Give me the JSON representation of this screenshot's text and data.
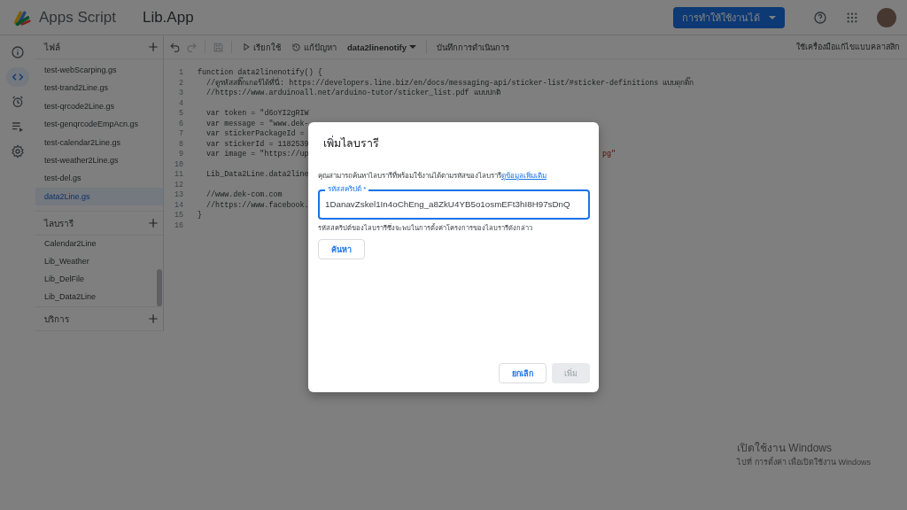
{
  "app": {
    "name": "Apps Script",
    "project": "Lib.App",
    "deploy_button": "การทำให้ใช้งานได้"
  },
  "rail": [
    {
      "kind": "info",
      "selected": false
    },
    {
      "kind": "code",
      "selected": true
    },
    {
      "kind": "alarm",
      "selected": false
    },
    {
      "kind": "runs",
      "selected": false
    },
    {
      "kind": "settings",
      "selected": false
    }
  ],
  "files": {
    "title": "ไฟล์",
    "items": [
      {
        "label": "test-webScarping.gs",
        "selected": false
      },
      {
        "label": "test-trand2Line.gs",
        "selected": false
      },
      {
        "label": "test-qrcode2Line.gs",
        "selected": false
      },
      {
        "label": "test-genqrcodeEmpAcn.gs",
        "selected": false
      },
      {
        "label": "test-calendar2Line.gs",
        "selected": false
      },
      {
        "label": "test-weather2Line.gs",
        "selected": false
      },
      {
        "label": "test-del.gs",
        "selected": false
      },
      {
        "label": "data2Line.gs",
        "selected": true
      }
    ]
  },
  "libraries": {
    "title": "ไลบรารี",
    "items": [
      "Calendar2Line",
      "Lib_Weather",
      "Lib_DelFile",
      "Lib_Data2Line"
    ]
  },
  "services": {
    "title": "บริการ"
  },
  "toolbar": {
    "run": "เรียกใช้",
    "debug": "แก้ปัญหา",
    "function": "data2linenotify",
    "log": "บันทึกการดำเนินการ",
    "classic": "ใช้เครื่องมือแก้ไขแบบคลาสสิก"
  },
  "code": [
    {
      "n": "1",
      "text": "function data2linenotify() {"
    },
    {
      "n": "2",
      "text": "  //ดูรหัสสติ๊กเกอร์ได้ที่นี่: https://developers.line.biz/en/docs/messaging-api/sticker-list/#sticker-definitions แบบดุกดิ๊ก"
    },
    {
      "n": "3",
      "text": "  //https://www.arduinoall.net/arduino-tutor/sticker_list.pdf แบบปกติ"
    },
    {
      "n": "4"
    },
    {
      "n": "5",
      "text": "  var token = \"d6oYI2gRIW"
    },
    {
      "n": "6",
      "text": "  var message = \"www.dek-"
    },
    {
      "n": "7",
      "text": "  var stickerPackageId = "
    },
    {
      "n": "8",
      "text": "  var stickerId = 1182539"
    },
    {
      "n": "9",
      "text": "  var image = \"https://up",
      "tail": "pg\""
    },
    {
      "n": "10"
    },
    {
      "n": "11",
      "text": "  Lib_Data2Line.data2line"
    },
    {
      "n": "12"
    },
    {
      "n": "13",
      "text": "  //www.dek-com.com"
    },
    {
      "n": "14",
      "text": "  //https://www.facebook."
    },
    {
      "n": "15",
      "text": "}"
    },
    {
      "n": "16"
    }
  ],
  "dialog": {
    "title": "เพิ่มไลบรารี",
    "description": "คุณสามารถค้นหาไลบรารีที่พร้อมใช้งานได้ตามรหัสของไลบรารี",
    "link": "ดูข้อมูลเพิ่มเติม",
    "field_label": "รหัสสคริปต์ *",
    "field_value": "1DanavZskel1In4oChEng_a8ZkU4YB5o1osmEFt3hI8H97sDnQ",
    "helper": "รหัสสคริปต์ของไลบรารีซึ่งจะพบในการตั้งค่าโครงการของไลบรารีดังกล่าว",
    "search_button": "ค้นหา",
    "cancel_button": "ยกเลิก",
    "add_button": {
      "label": "เพิ่ม",
      "disabled": true
    }
  },
  "activation": {
    "title": "เปิดใช้งาน Windows",
    "subtitle": "ไปที่ การตั้งค่า เพื่อเปิดใช้งาน Windows"
  }
}
